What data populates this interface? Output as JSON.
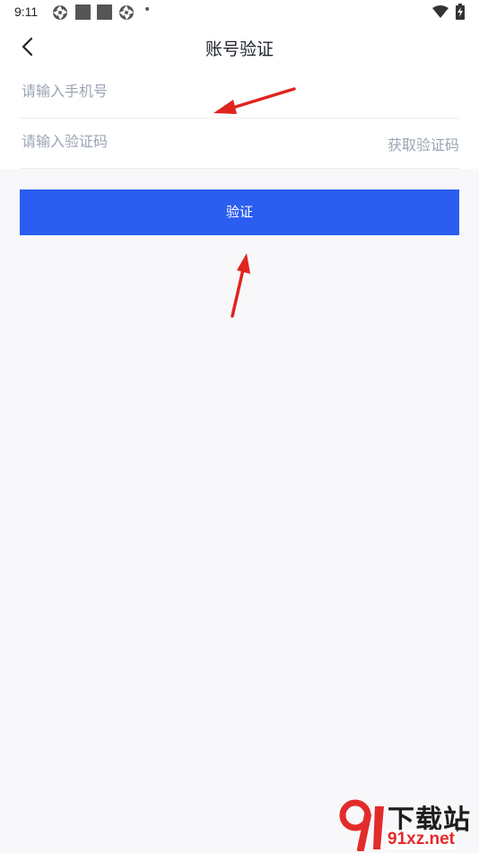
{
  "status_bar": {
    "time": "9:11",
    "dot": "•"
  },
  "header": {
    "title": "账号验证",
    "back_icon": "chevron-left-icon"
  },
  "form": {
    "phone_placeholder": "请输入手机号",
    "code_placeholder": "请输入验证码",
    "get_code_label": "获取验证码"
  },
  "verify_button": {
    "label": "验证",
    "color": "#2b5ef0"
  },
  "annotations": {
    "arrow_color": "#e0241f"
  },
  "watermark": {
    "brand": "下载站",
    "url": "91xz.net"
  }
}
